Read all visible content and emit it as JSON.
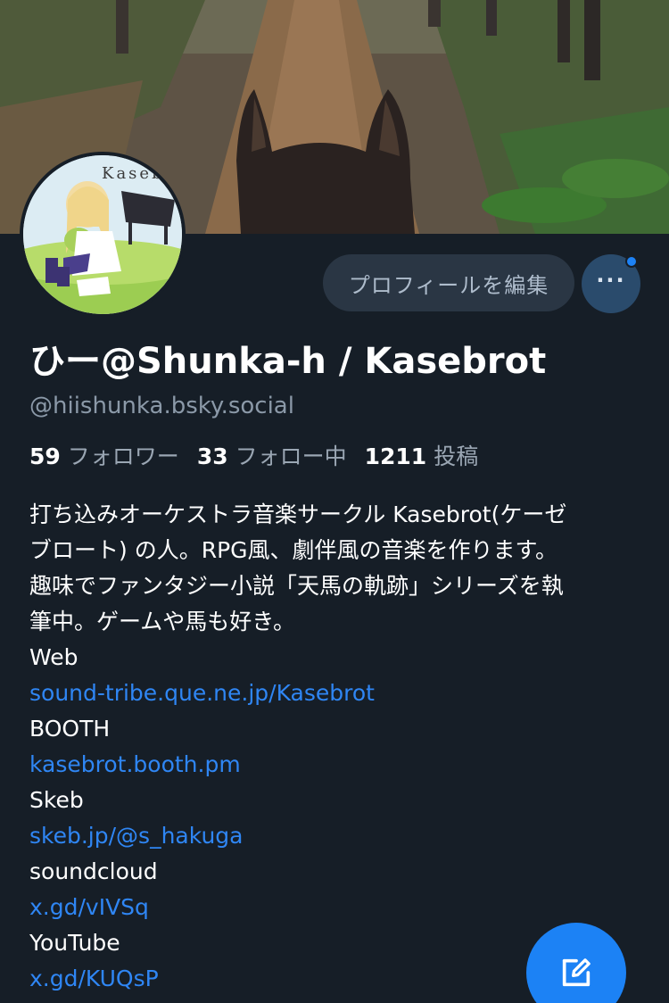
{
  "profile": {
    "display_name": "ひー@Shunka-h / Kasebrot",
    "handle": "@hiishunka.bsky.social",
    "avatar_text": "Kaseb",
    "edit_profile_label": "プロフィールを編集",
    "more_label": "···"
  },
  "stats": {
    "followers_count": "59",
    "followers_label": "フォロワー",
    "following_count": "33",
    "following_label": "フォロー中",
    "posts_count": "1211",
    "posts_label": "投稿"
  },
  "bio": {
    "lines": [
      "打ち込みオーケストラ音楽サークル Kasebrot(ケーゼ",
      "ブロート) の人。RPG風、劇伴風の音楽を作ります。",
      "趣味でファンタジー小説「天馬の軌跡」シリーズを執",
      "筆中。ゲームや馬も好き。"
    ],
    "links": [
      {
        "label": "Web",
        "url": "sound-tribe.que.ne.jp/Kasebrot"
      },
      {
        "label": "BOOTH",
        "url": "kasebrot.booth.pm"
      },
      {
        "label": "Skeb",
        "url": "skeb.jp/@s_hakuga"
      },
      {
        "label": "soundcloud",
        "url": "x.gd/vIVSq"
      },
      {
        "label": "YouTube",
        "url": "x.gd/KUQsP"
      }
    ]
  },
  "icons": {
    "more": "more-horizontal-icon",
    "compose": "compose-pencil-icon",
    "notification": "notification-dot-icon"
  },
  "colors": {
    "background": "#161e27",
    "link": "#2f86f4",
    "accent": "#1c82f5",
    "muted": "#8b99a8"
  }
}
